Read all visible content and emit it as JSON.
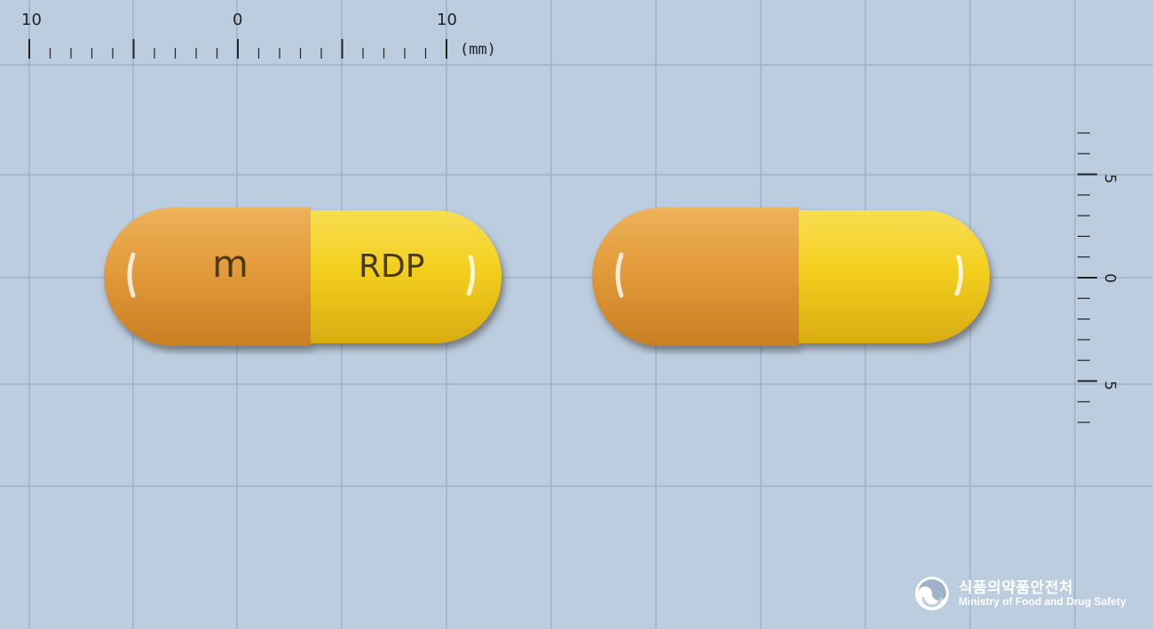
{
  "ruler_top": {
    "tick_labels": [
      "10",
      "0",
      "10"
    ],
    "unit": "(mm)"
  },
  "ruler_side": {
    "tick_labels": [
      "5",
      "0",
      "5"
    ]
  },
  "capsules": [
    {
      "cap_color": "#e29a3a",
      "body_color": "#f3cf1e",
      "imprint_cap": "m",
      "imprint_body": "RDP"
    },
    {
      "cap_color": "#e29a3a",
      "body_color": "#f3cf1e"
    }
  ],
  "colors": {
    "background": "#bccde0",
    "grid_line": "#9fb2c9",
    "ink": "#222222"
  },
  "logo": {
    "korean": "식품의약품안전처",
    "english": "Ministry of Food and Drug Safety"
  }
}
